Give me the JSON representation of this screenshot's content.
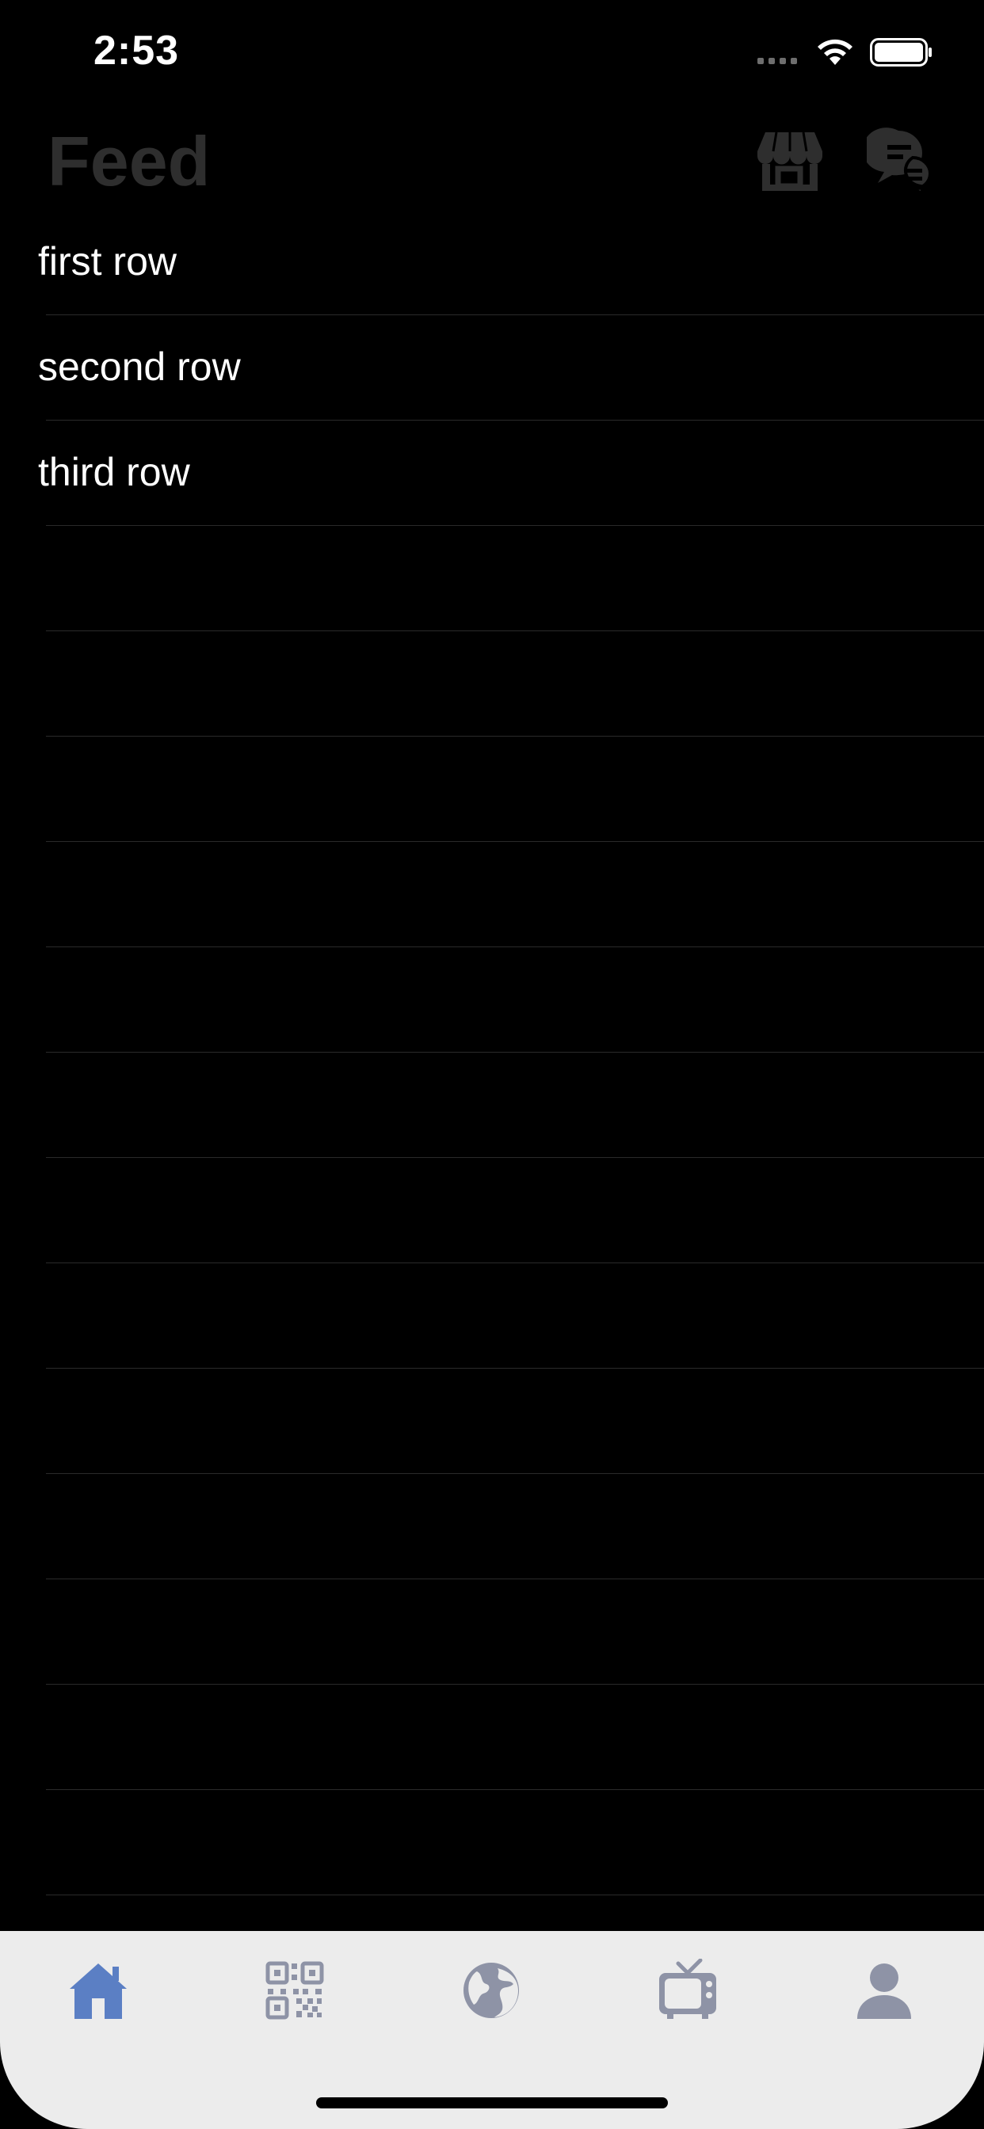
{
  "status_bar": {
    "time": "2:53"
  },
  "header": {
    "title": "Feed",
    "store_icon": "store-icon",
    "chat_icon": "chat-bubbles-icon"
  },
  "rows": [
    {
      "label": "first row"
    },
    {
      "label": "second row"
    },
    {
      "label": "third row"
    },
    {
      "label": ""
    },
    {
      "label": ""
    },
    {
      "label": ""
    },
    {
      "label": ""
    },
    {
      "label": ""
    },
    {
      "label": ""
    },
    {
      "label": ""
    },
    {
      "label": ""
    },
    {
      "label": ""
    },
    {
      "label": ""
    },
    {
      "label": ""
    },
    {
      "label": ""
    },
    {
      "label": ""
    }
  ],
  "tab_bar": {
    "tabs": [
      {
        "icon": "home-icon",
        "selected": true
      },
      {
        "icon": "qr-code-icon",
        "selected": false
      },
      {
        "icon": "globe-icon",
        "selected": false
      },
      {
        "icon": "tv-icon",
        "selected": false
      },
      {
        "icon": "person-icon",
        "selected": false
      }
    ]
  },
  "colors": {
    "background": "#000000",
    "title": "#2e2e2e",
    "separator": "#2a2a2a",
    "tab_bar_bg": "#ececec",
    "tab_active": "#5b7fc4",
    "tab_inactive": "#8e93a6"
  }
}
